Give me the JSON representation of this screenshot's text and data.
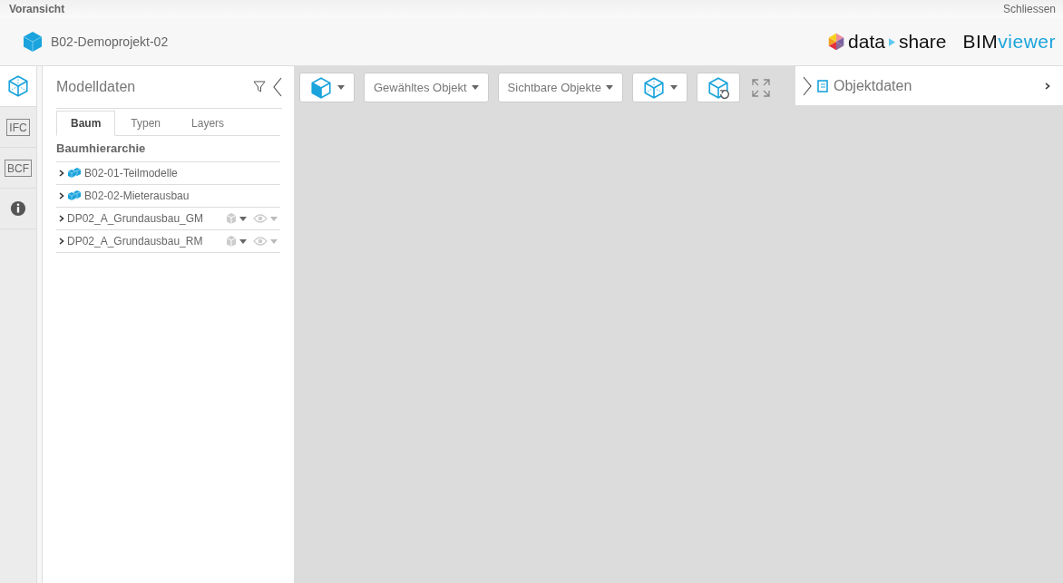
{
  "window": {
    "title": "Voransicht",
    "close": "Schliessen"
  },
  "header": {
    "project": "B02-Demoprojekt-02",
    "brand": {
      "left": "data",
      "right": "share"
    },
    "product": {
      "main": "BIM",
      "accent": "viewer"
    }
  },
  "rail": [
    {
      "kind": "model",
      "selected": true
    },
    {
      "kind": "folder",
      "label": "IFC",
      "selected": false
    },
    {
      "kind": "folder",
      "label": "BCF",
      "selected": false
    },
    {
      "kind": "info",
      "selected": false
    }
  ],
  "panel": {
    "title": "Modelldaten",
    "tabs": [
      {
        "label": "Baum",
        "selected": true
      },
      {
        "label": "Typen",
        "selected": false
      },
      {
        "label": "Layers",
        "selected": false
      }
    ],
    "section": "Baumhierarchie",
    "tree": [
      {
        "label": "B02-01-Teilmodelle",
        "kind": "group"
      },
      {
        "label": "B02-02-Mieterausbau",
        "kind": "group"
      },
      {
        "label": "DP02_A_Grundausbau_GM",
        "kind": "model"
      },
      {
        "label": "DP02_A_Grundausbau_RM",
        "kind": "model"
      }
    ]
  },
  "toolbar": [
    {
      "kind": "cube-half",
      "caret": true
    },
    {
      "kind": "text",
      "label": "Gewähltes Objekt"
    },
    {
      "kind": "text",
      "label": "Sichtbare Objekte"
    },
    {
      "kind": "cube",
      "caret": true
    },
    {
      "kind": "cube-reset",
      "caret": false
    }
  ],
  "objectPanel": {
    "title": "Objektdaten"
  }
}
